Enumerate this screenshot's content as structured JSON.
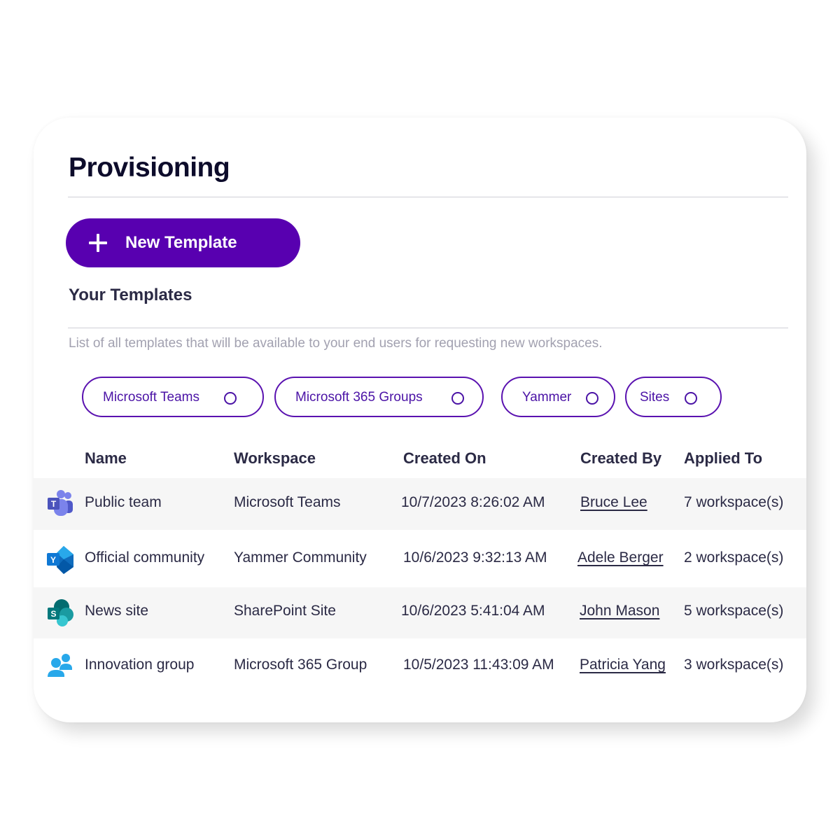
{
  "page": {
    "title": "Provisioning",
    "new_template_button": "New Template",
    "section_title": "Your Templates",
    "description": "List of all templates that will be available to your end users for requesting new workspaces."
  },
  "filters": [
    {
      "label": "Microsoft Teams",
      "selected": false
    },
    {
      "label": "Microsoft 365 Groups",
      "selected": false
    },
    {
      "label": "Yammer",
      "selected": false
    },
    {
      "label": "Sites",
      "selected": false
    }
  ],
  "table": {
    "columns": [
      "Name",
      "Workspace",
      "Created On",
      "Created By",
      "Applied To"
    ],
    "rows": [
      {
        "icon": "microsoft-teams-icon",
        "name": "Public team",
        "workspace": "Microsoft Teams",
        "created_on": "10/7/2023 8:26:02 AM",
        "created_by": "Bruce Lee",
        "applied_to": "7 workspace(s)"
      },
      {
        "icon": "yammer-icon",
        "name": "Official community",
        "workspace": "Yammer Community",
        "created_on": "10/6/2023 9:32:13 AM",
        "created_by": "Adele Berger",
        "applied_to": "2 workspace(s)"
      },
      {
        "icon": "sharepoint-icon",
        "name": "News site",
        "workspace": "SharePoint Site",
        "created_on": "10/6/2023 5:41:04 AM",
        "created_by": "John Mason",
        "applied_to": "5 workspace(s)"
      },
      {
        "icon": "microsoft-365-group-icon",
        "name": "Innovation group",
        "workspace": "Microsoft 365 Group",
        "created_on": "10/5/2023 11:43:09 AM",
        "created_by": "Patricia Yang",
        "applied_to": "3 workspace(s)"
      }
    ]
  },
  "colors": {
    "accent": "#5800b0",
    "chip_border": "#5a12b0",
    "text": "#2b2a45",
    "muted_text": "#a2a1b0",
    "row_shade": "#f6f6f6"
  }
}
